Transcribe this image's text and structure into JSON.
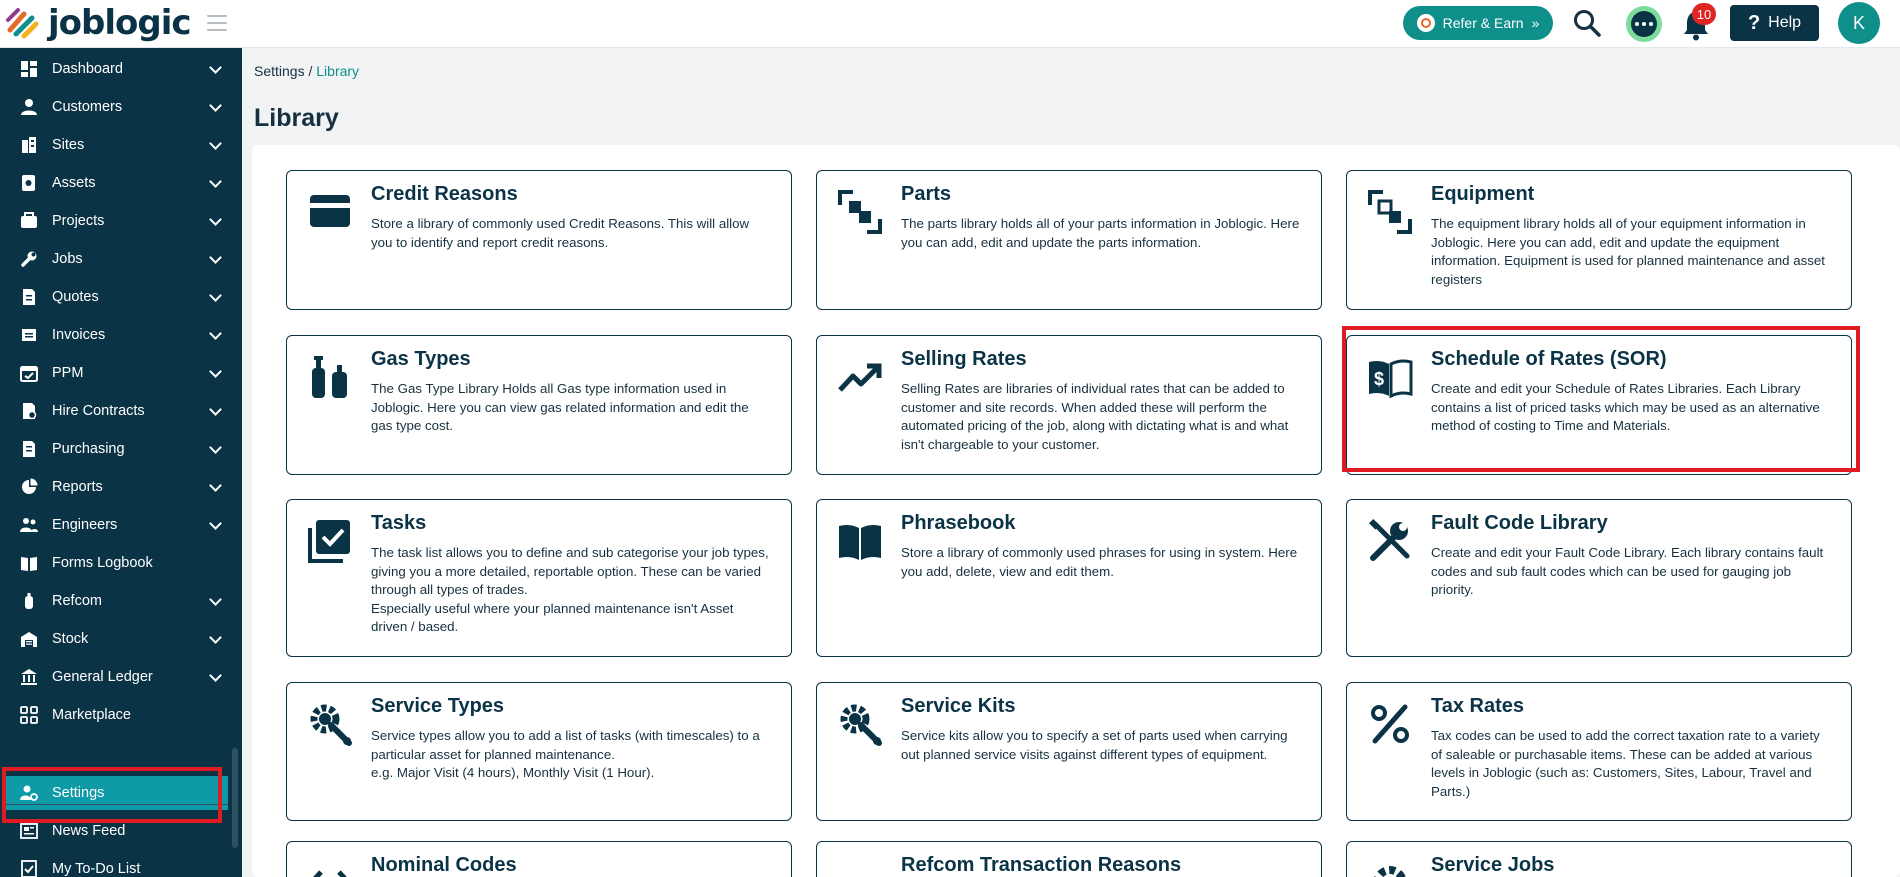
{
  "header": {
    "logo_text": "joblogic",
    "refer_label": "Refer & Earn",
    "notification_count": "10",
    "help_label": "Help",
    "avatar_initial": "K"
  },
  "sidebar": {
    "items": [
      {
        "label": "Dashboard",
        "icon": "dashboard-icon"
      },
      {
        "label": "Customers",
        "icon": "user-icon"
      },
      {
        "label": "Sites",
        "icon": "building-icon"
      },
      {
        "label": "Assets",
        "icon": "asset-icon"
      },
      {
        "label": "Projects",
        "icon": "projects-icon"
      },
      {
        "label": "Jobs",
        "icon": "wrench-icon"
      },
      {
        "label": "Quotes",
        "icon": "quotes-icon"
      },
      {
        "label": "Invoices",
        "icon": "invoice-icon"
      },
      {
        "label": "PPM",
        "icon": "calendar-icon"
      },
      {
        "label": "Hire Contracts",
        "icon": "contract-icon"
      },
      {
        "label": "Purchasing",
        "icon": "purchasing-icon"
      },
      {
        "label": "Reports",
        "icon": "pie-chart-icon"
      },
      {
        "label": "Engineers",
        "icon": "engineers-icon"
      },
      {
        "label": "Forms Logbook",
        "icon": "book-icon"
      },
      {
        "label": "Refcom",
        "icon": "cylinder-icon"
      },
      {
        "label": "Stock",
        "icon": "warehouse-icon"
      },
      {
        "label": "General Ledger",
        "icon": "bank-icon"
      },
      {
        "label": "Marketplace",
        "icon": "grid-icon"
      },
      {
        "label": "Settings",
        "icon": "user-gear-icon"
      },
      {
        "label": "News Feed",
        "icon": "news-icon"
      },
      {
        "label": "My To-Do List",
        "icon": "todo-icon"
      }
    ]
  },
  "breadcrumb": {
    "root": "Settings",
    "separator": " / ",
    "current": "Library"
  },
  "page_title": "Library",
  "cards": [
    {
      "title": "Credit Reasons",
      "icon": "credit-card-icon",
      "desc": "Store a library of commonly used Credit Reasons. This will allow you to identify and report credit reasons."
    },
    {
      "title": "Parts",
      "icon": "parts-icon",
      "desc": "The parts library holds all of your parts information in Joblogic. Here you can add, edit and update the parts information."
    },
    {
      "title": "Equipment",
      "icon": "equipment-icon",
      "desc": "The equipment library holds all of your equipment information in Joblogic. Here you can add, edit and update the equipment information. Equipment is used for planned maintenance and asset registers"
    },
    {
      "title": "Gas Types",
      "icon": "gas-cylinder-icon",
      "desc": "The Gas Type Library Holds all Gas type information used in Joblogic. Here you can view gas related information and edit the gas type cost."
    },
    {
      "title": "Selling Rates",
      "icon": "trending-up-icon",
      "desc": "Selling Rates are libraries of individual rates that can be added to customer and site records. When added these will perform the automated pricing of the job, along with dictating what is and what isn't chargeable to your customer."
    },
    {
      "title": "Schedule of Rates (SOR)",
      "icon": "dollar-book-icon",
      "desc": "Create and edit your Schedule of Rates Libraries. Each Library contains a list of priced tasks which may be used as an alternative method of costing to Time and Materials."
    },
    {
      "title": "Tasks",
      "icon": "task-check-icon",
      "desc": "The task list allows you to define and sub categorise your job types, giving you a more detailed, reportable option. These can be varied through all types of trades.",
      "desc2": "Especially useful where your planned maintenance isn't Asset driven / based."
    },
    {
      "title": "Phrasebook",
      "icon": "open-book-icon",
      "desc": "Store a library of commonly used phrases for using in system. Here you add, delete, view and edit them."
    },
    {
      "title": "Fault Code Library",
      "icon": "tools-icon",
      "desc": "Create and edit your Fault Code Library. Each library contains fault codes and sub fault codes which can be used for gauging job priority."
    },
    {
      "title": "Service Types",
      "icon": "gear-wrench-icon",
      "desc": "Service types allow you to add a list of tasks (with timescales) to a particular asset for planned maintenance.",
      "desc2": "e.g. Major Visit (4 hours), Monthly Visit (1 Hour)."
    },
    {
      "title": "Service Kits",
      "icon": "gear-wrench-icon",
      "desc": "Service kits allow you to specify a set of parts used when carrying out planned service visits against different types of equipment."
    },
    {
      "title": "Tax Rates",
      "icon": "percent-icon",
      "desc": "Tax codes can be used to add the correct taxation rate to a variety of saleable or purchasable items. These can be added at various levels in Joblogic (such as: Customers, Sites, Labour, Travel and Parts.)"
    },
    {
      "title": "Nominal Codes",
      "icon": "code-icon",
      "desc": ""
    },
    {
      "title": "Refcom Transaction Reasons",
      "icon": "cylinder-icon",
      "desc": ""
    },
    {
      "title": "Service Jobs",
      "icon": "gear-icon",
      "desc": ""
    }
  ]
}
